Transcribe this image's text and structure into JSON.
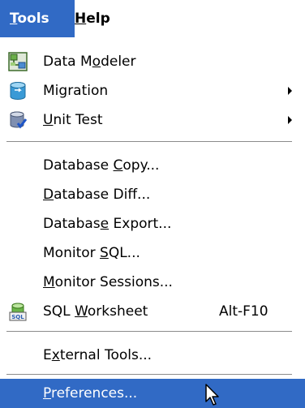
{
  "menubar": {
    "tools": {
      "pre": "",
      "u": "T",
      "post": "ools"
    },
    "help": {
      "pre": "",
      "u": "H",
      "post": "elp"
    }
  },
  "items": [
    {
      "pre": "Data M",
      "u": "o",
      "post": "deler",
      "icon": "data-modeler-icon"
    },
    {
      "pre": "Mi",
      "u": "g",
      "post": "ration",
      "icon": "migration-icon",
      "submenu": true
    },
    {
      "pre": "",
      "u": "U",
      "post": "nit Test",
      "icon": "unit-test-icon",
      "submenu": true
    },
    {
      "pre": "Database ",
      "u": "C",
      "post": "opy..."
    },
    {
      "pre": "",
      "u": "D",
      "post": "atabase Diff..."
    },
    {
      "pre": "Databas",
      "u": "e",
      "post": " Export..."
    },
    {
      "pre": "Monitor ",
      "u": "S",
      "post": "QL..."
    },
    {
      "pre": "",
      "u": "M",
      "post": "onitor Sessions..."
    },
    {
      "pre": "SQL ",
      "u": "W",
      "post": "orksheet",
      "icon": "sql-worksheet-icon",
      "shortcut": "Alt-F10"
    },
    {
      "pre": "E",
      "u": "x",
      "post": "ternal Tools..."
    },
    {
      "pre": "",
      "u": "P",
      "post": "references...",
      "selected": true
    }
  ],
  "colors": {
    "selection": "#316ac5"
  }
}
